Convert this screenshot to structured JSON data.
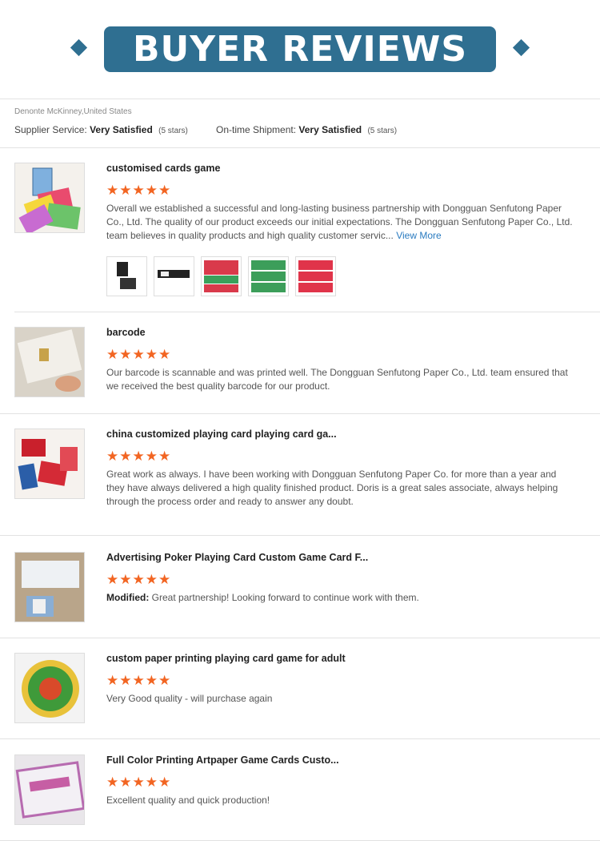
{
  "header": {
    "title": "BUYER REVIEWS"
  },
  "buyer": {
    "name": "Denonte McKinney,United States",
    "supplier_label": "Supplier Service:",
    "supplier_value": "Very Satisfied",
    "supplier_stars": "(5 stars)",
    "shipment_label": "On-time Shipment:",
    "shipment_value": "Very Satisfied",
    "shipment_stars": "(5 stars)"
  },
  "reviews": [
    {
      "title": "customised cards game",
      "stars": "★★★★★",
      "text": "Overall we established a successful and long-lasting business partnership with Dongguan Senfutong Paper Co., Ltd. The quality of our product exceeds our initial expectations. The Dongguan Senfutong Paper Co., Ltd. team believes in quality products and high quality customer servic...",
      "view_more": "View More",
      "image": "card-game-box-photo"
    },
    {
      "title": "barcode",
      "stars": "★★★★★",
      "text": "Our barcode is scannable and was printed well. The Dongguan Senfutong Paper Co., Ltd. team ensured that we received the best quality barcode for our product.",
      "image": "barcode-card-photo"
    },
    {
      "title": "china customized playing card playing card ga...",
      "stars": "★★★★★",
      "text": "Great work as always. I have been working with Dongguan Senfutong Paper Co. for more than a year and they have always delivered a high quality finished product. Doris is a great sales associate, always helping through the process order and ready to answer any doubt.",
      "image": "red-playing-cards-photo"
    },
    {
      "title": "Advertising Poker Playing Card Custom Game Card F...",
      "stars": "★★★★★",
      "modified_label": "Modified:",
      "text": "Great partnership! Looking forward to continue work with them.",
      "image": "poker-cards-photo"
    },
    {
      "title": "custom paper printing playing card game for adult",
      "stars": "★★★★★",
      "text": "Very Good quality - will purchase again",
      "image": "round-card-photo"
    },
    {
      "title": "Full Color Printing Artpaper Game Cards Custo...",
      "stars": "★★★★★",
      "text": "Excellent quality and quick production!",
      "image": "game-card-box-photo"
    }
  ],
  "colors": {
    "banner": "#2f6f91",
    "stars": "#f26522",
    "link": "#2a7bc0"
  }
}
